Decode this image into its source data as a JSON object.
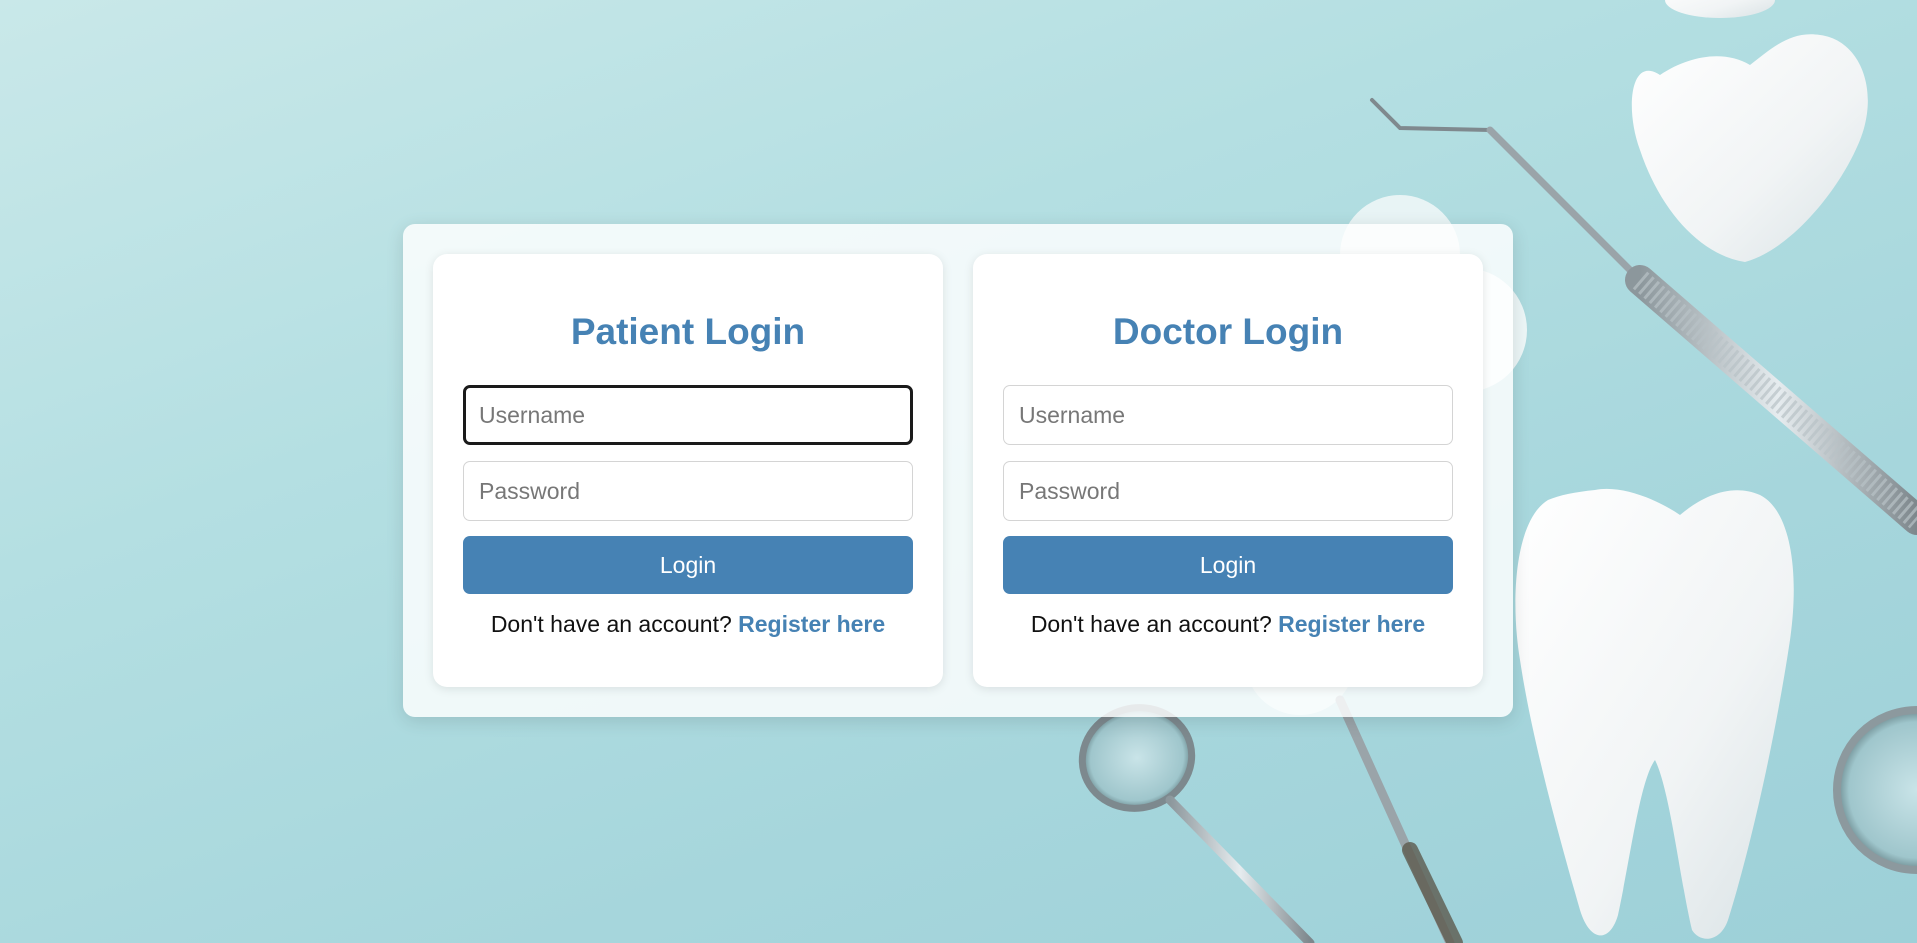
{
  "patient_login": {
    "title": "Patient Login",
    "username_placeholder": "Username",
    "password_placeholder": "Password",
    "login_label": "Login",
    "register_prompt": "Don't have an account? ",
    "register_link": "Register here"
  },
  "doctor_login": {
    "title": "Doctor Login",
    "username_placeholder": "Username",
    "password_placeholder": "Password",
    "login_label": "Login",
    "register_prompt": "Don't have an account? ",
    "register_link": "Register here"
  },
  "colors": {
    "accent": "#4682b4",
    "background": "#a6d6dc",
    "card": "#ffffff"
  }
}
